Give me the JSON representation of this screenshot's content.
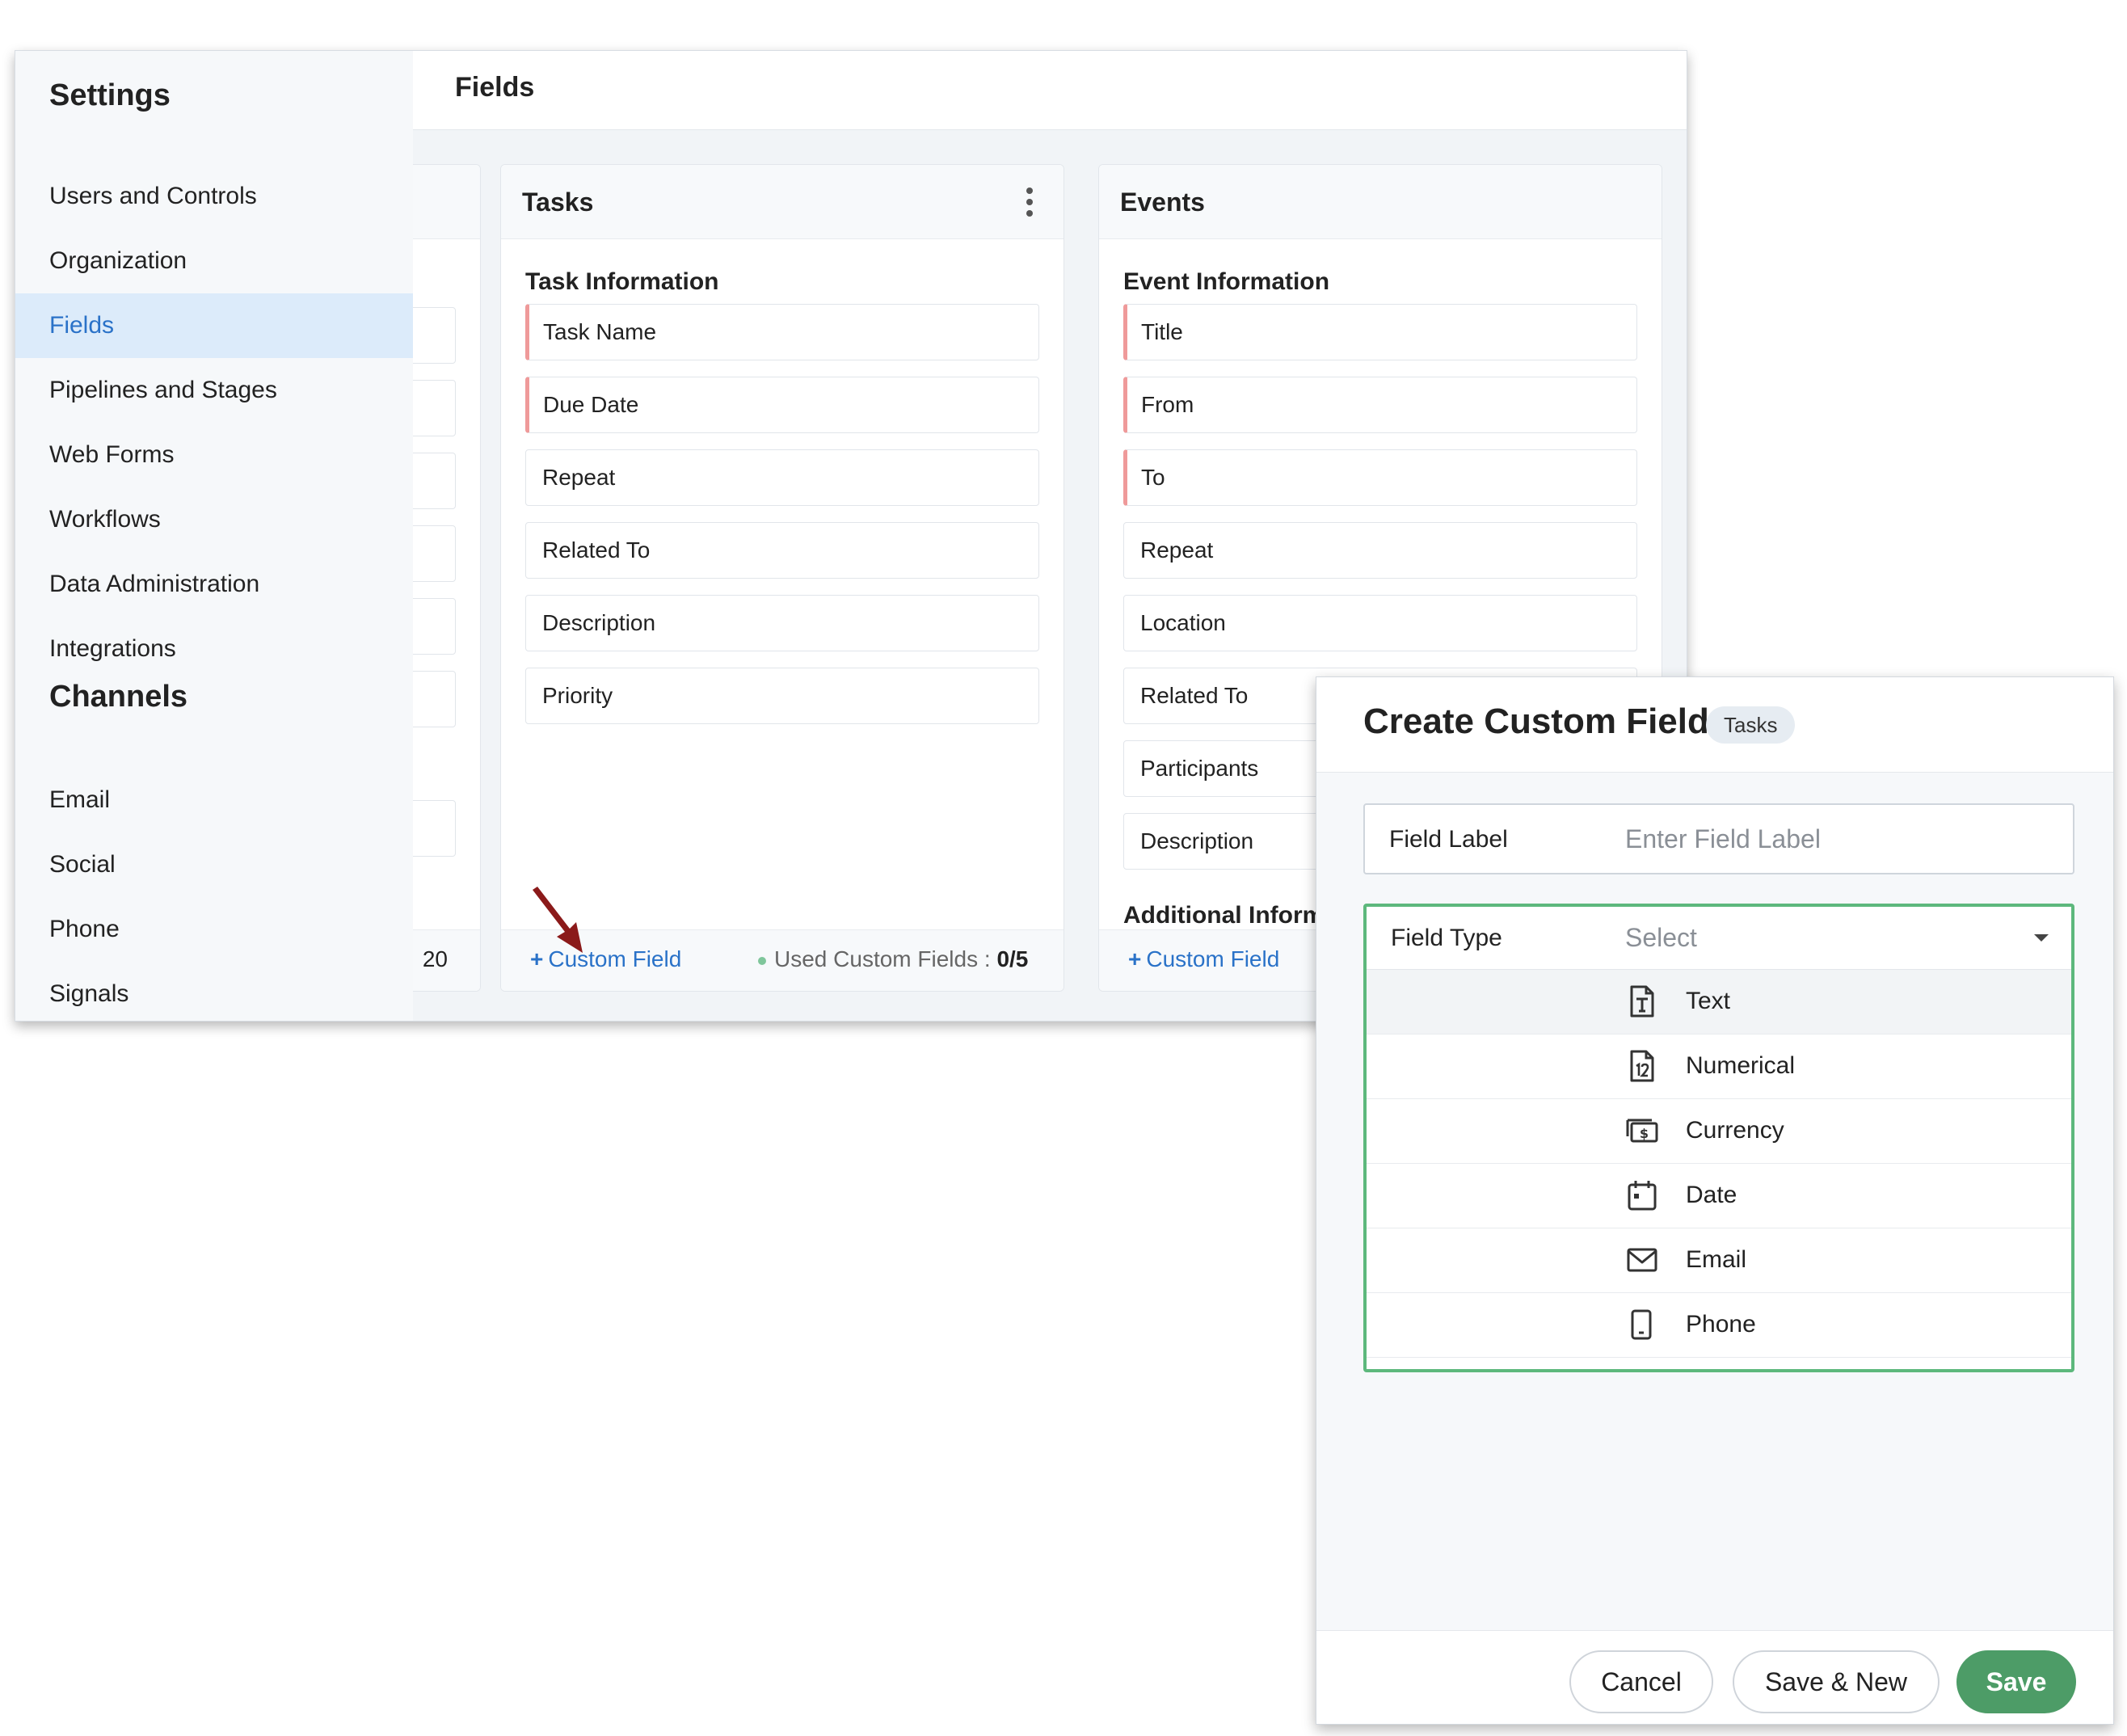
{
  "sidebar": {
    "settings_heading": "Settings",
    "settings_items": [
      {
        "label": "Users and Controls"
      },
      {
        "label": "Organization"
      },
      {
        "label": "Fields"
      },
      {
        "label": "Pipelines and Stages"
      },
      {
        "label": "Web Forms"
      },
      {
        "label": "Workflows"
      },
      {
        "label": "Data Administration"
      },
      {
        "label": "Integrations"
      }
    ],
    "active_item": "Fields",
    "channels_heading": "Channels",
    "channel_items": [
      {
        "label": "Email"
      },
      {
        "label": "Social"
      },
      {
        "label": "Phone"
      },
      {
        "label": "Signals"
      }
    ]
  },
  "main": {
    "title": "Fields",
    "partial_card": {
      "count_fragment": "20"
    },
    "tasks_card": {
      "title": "Tasks",
      "section": "Task Information",
      "fields": [
        {
          "label": "Task Name",
          "mandatory": true
        },
        {
          "label": "Due Date",
          "mandatory": true
        },
        {
          "label": "Repeat",
          "mandatory": false
        },
        {
          "label": "Related To",
          "mandatory": false
        },
        {
          "label": "Description",
          "mandatory": false
        },
        {
          "label": "Priority",
          "mandatory": false
        }
      ],
      "footer": {
        "custom_field_link": "Custom Field",
        "used_label": "Used Custom Fields",
        "used_value": "0/5"
      }
    },
    "events_card": {
      "title": "Events",
      "section": "Event Information",
      "fields": [
        {
          "label": "Title",
          "mandatory": true
        },
        {
          "label": "From",
          "mandatory": true
        },
        {
          "label": "To",
          "mandatory": true
        },
        {
          "label": "Repeat",
          "mandatory": false
        },
        {
          "label": "Location",
          "mandatory": false
        },
        {
          "label": "Related To",
          "mandatory": false
        },
        {
          "label": "Participants",
          "mandatory": false
        },
        {
          "label": "Description",
          "mandatory": false
        }
      ],
      "additional_section": "Additional Informa",
      "footer": {
        "custom_field_link": "Custom Field"
      }
    }
  },
  "create_panel": {
    "title": "Create Custom Field",
    "badge": "Tasks",
    "field_label": {
      "label": "Field Label",
      "placeholder": "Enter Field Label",
      "value": ""
    },
    "field_type": {
      "label": "Field Type",
      "selected": "Select",
      "options": [
        {
          "label": "Text",
          "icon": "text-field-icon"
        },
        {
          "label": "Numerical",
          "icon": "number-field-icon"
        },
        {
          "label": "Currency",
          "icon": "currency-icon"
        },
        {
          "label": "Date",
          "icon": "calendar-icon"
        },
        {
          "label": "Email",
          "icon": "envelope-icon"
        },
        {
          "label": "Phone",
          "icon": "phone-icon"
        }
      ],
      "hovered_option": "Text"
    },
    "buttons": {
      "cancel": "Cancel",
      "save_new": "Save & New",
      "save": "Save"
    }
  },
  "colors": {
    "accent_blue": "#2a72c8",
    "active_sidebar_bg": "#dcebfa",
    "mandatory_marker": "#ef9a9a",
    "focus_green": "#5db87c",
    "save_green": "#4d9c67",
    "arrow": "#8b1a1a"
  }
}
